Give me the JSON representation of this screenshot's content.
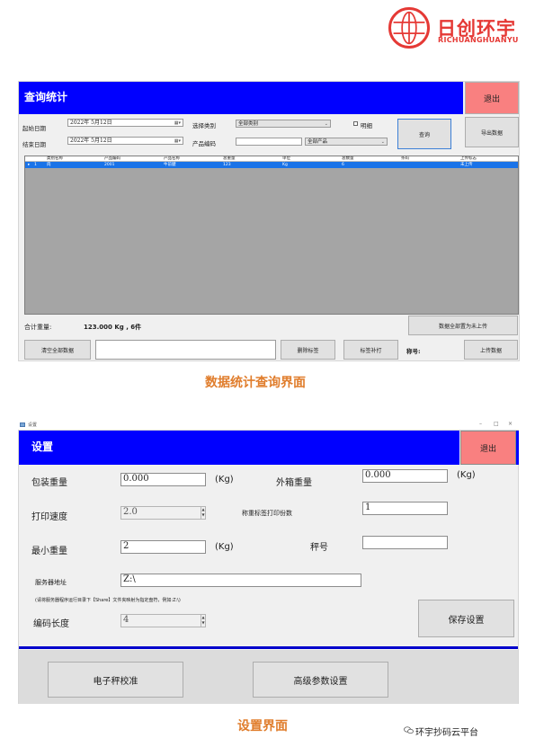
{
  "logo": {
    "cn": "日创环宇",
    "en": "RICHUANGHUANYU"
  },
  "query_panel": {
    "title": "查询统计",
    "exit_label": "退出",
    "start_date_label": "起始日期",
    "start_date_value": "2022年 5月12日",
    "end_date_label": "结束日期",
    "end_date_value": "2022年 5月12日",
    "category_label": "选择类别",
    "category_value": "全部类别",
    "product_code_label": "产品编码",
    "product_code_value": "",
    "product_select_value": "全部产品",
    "detail_label": "明细",
    "query_button": "查询",
    "export_button": "导出数据",
    "grid": {
      "columns": [
        "类别名称",
        "产品编码",
        "产品名称",
        "总重量",
        "单位",
        "总数量",
        "条码",
        "上传标志"
      ],
      "rows": [
        {
          "marker": "▸",
          "index": "1",
          "cells": [
            "肉",
            "2001",
            "牛前腱",
            "123",
            "Kg",
            "6",
            "",
            "未上传"
          ]
        }
      ]
    },
    "total_label": "合计重量:",
    "total_value": "123.000 Kg , 6件",
    "mark_all_button": "数据全部置为未上传",
    "clear_button": "清空全部数据",
    "delete_tag_button": "删除标签",
    "reprint_button": "标签补打",
    "scale_no_label": "称号:",
    "upload_button": "上传数据"
  },
  "caption1": "数据统计查询界面",
  "settings_window": {
    "window_title": "设置",
    "win_controls": [
      "–",
      "□",
      "×"
    ],
    "title": "设置",
    "exit_label": "退出",
    "pack_weight_label": "包装重量",
    "pack_weight_value": "0.000",
    "kg1": "(Kg)",
    "outer_weight_label": "外箱重量",
    "outer_weight_value": "0.000",
    "kg2": "(Kg)",
    "print_speed_label": "打印速度",
    "print_speed_value": "2.0",
    "label_copies_label": "称重标签打印份数",
    "label_copies_value": "1",
    "min_weight_label": "最小重量",
    "min_weight_value": "2",
    "kg3": "(Kg)",
    "scale_no_label": "秤号",
    "scale_no_value": "",
    "server_label": "服务器地址",
    "server_value": "Z:\\",
    "server_hint": "(请将服务器程序运行目录下【Share】文件夹映射为指定盘符，例如:Z:\\)",
    "code_length_label": "编码长度",
    "code_length_value": "4",
    "save_button": "保存设置",
    "calibrate_button": "电子秤校准",
    "advanced_button": "高级参数设置"
  },
  "caption2": "设置界面",
  "footer": "环宇抄码云平台",
  "colors": {
    "header_blue": "#0000ff",
    "exit_red": "#f98080",
    "caption_orange": "#e07d2c",
    "row_select": "#1a73e8"
  }
}
